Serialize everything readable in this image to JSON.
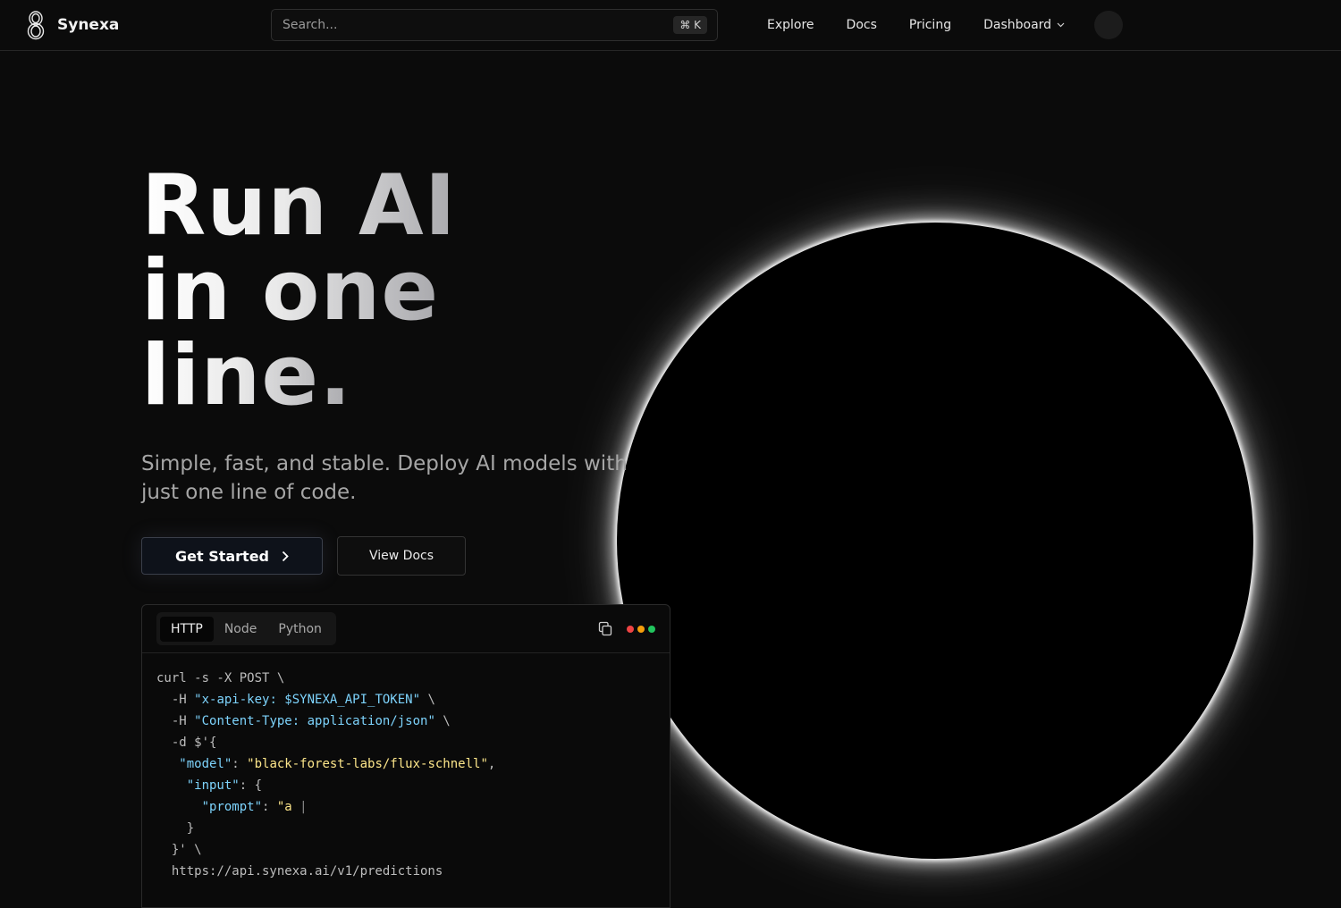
{
  "brand": {
    "name": "Synexa",
    "logo_icon": "infinity-8-logo-icon"
  },
  "search": {
    "placeholder": "Search...",
    "shortcut": "⌘ K"
  },
  "nav": {
    "explore": "Explore",
    "docs": "Docs",
    "pricing": "Pricing",
    "dashboard": "Dashboard"
  },
  "hero": {
    "title_line1": "Run AI",
    "title_line2": "in one",
    "title_line3": "line.",
    "subtitle": "Simple, fast, and stable. Deploy AI models with just one line of code.",
    "primary_cta": "Get Started",
    "secondary_cta": "View Docs"
  },
  "code_panel": {
    "tabs": [
      "HTTP",
      "Node",
      "Python"
    ],
    "active_tab": "HTTP",
    "window_dot_colors": [
      "#ef4444",
      "#f59e0b",
      "#22c55e"
    ],
    "lines": {
      "l1": "curl -s -X POST \\",
      "l2_flag": "  -H ",
      "l2_str": "\"x-api-key: $SYNEXA_API_TOKEN\"",
      "l2_tail": " \\",
      "l3_flag": "  -H ",
      "l3_str": "\"Content-Type: application/json\"",
      "l3_tail": " \\",
      "l4": "  -d $'{",
      "l5_key": "   \"model\"",
      "l5_sep": ": ",
      "l5_val": "\"black-forest-labs/flux-schnell\"",
      "l5_tail": ",",
      "l6_key": "    \"input\"",
      "l6_tail": ": {",
      "l7_key": "      \"prompt\"",
      "l7_sep": ": ",
      "l7_val": "\"a ",
      "l7_cursor": "|",
      "l8": "    }",
      "l9": "  }' \\",
      "l10": "  https://api.synexa.ai/v1/predictions"
    }
  },
  "colors": {
    "background": "#0b0b0b",
    "code_string": "#7dd3fc",
    "code_value": "#fde68a"
  }
}
